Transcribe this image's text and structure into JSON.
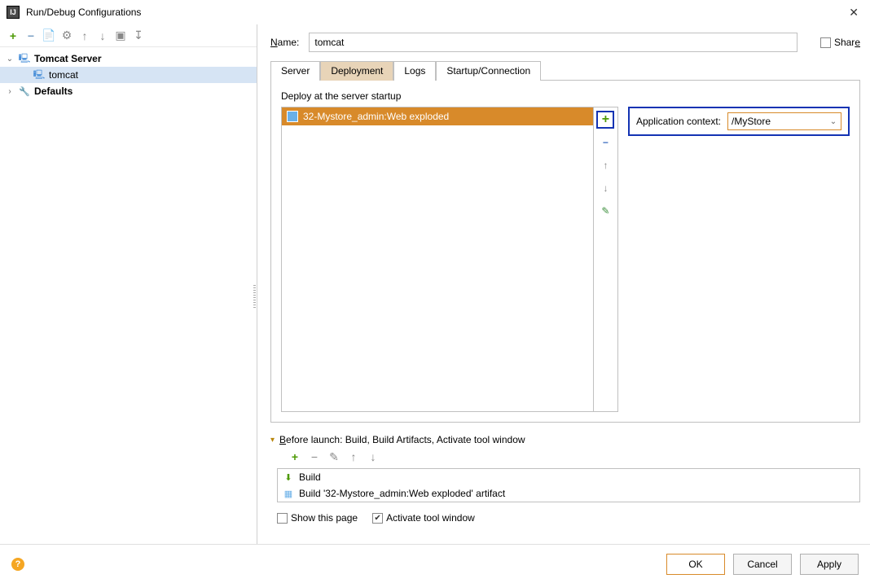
{
  "window": {
    "title": "Run/Debug Configurations"
  },
  "tree": {
    "root": "Tomcat Server",
    "child": "tomcat",
    "defaults": "Defaults"
  },
  "form": {
    "name_label": "Name:",
    "name_value": "tomcat",
    "share_label": "Share"
  },
  "tabs": {
    "server": "Server",
    "deployment": "Deployment",
    "logs": "Logs",
    "startup": "Startup/Connection"
  },
  "deploy": {
    "header": "Deploy at the server startup",
    "artifact": "32-Mystore_admin:Web exploded",
    "context_label": "Application context:",
    "context_value": "/MyStore"
  },
  "before_launch": {
    "title": "Before launch: Build, Build Artifacts, Activate tool window",
    "item1": "Build",
    "item2": "Build '32-Mystore_admin:Web exploded' artifact",
    "show_page": "Show this page",
    "activate": "Activate tool window"
  },
  "buttons": {
    "ok": "OK",
    "cancel": "Cancel",
    "apply": "Apply"
  }
}
